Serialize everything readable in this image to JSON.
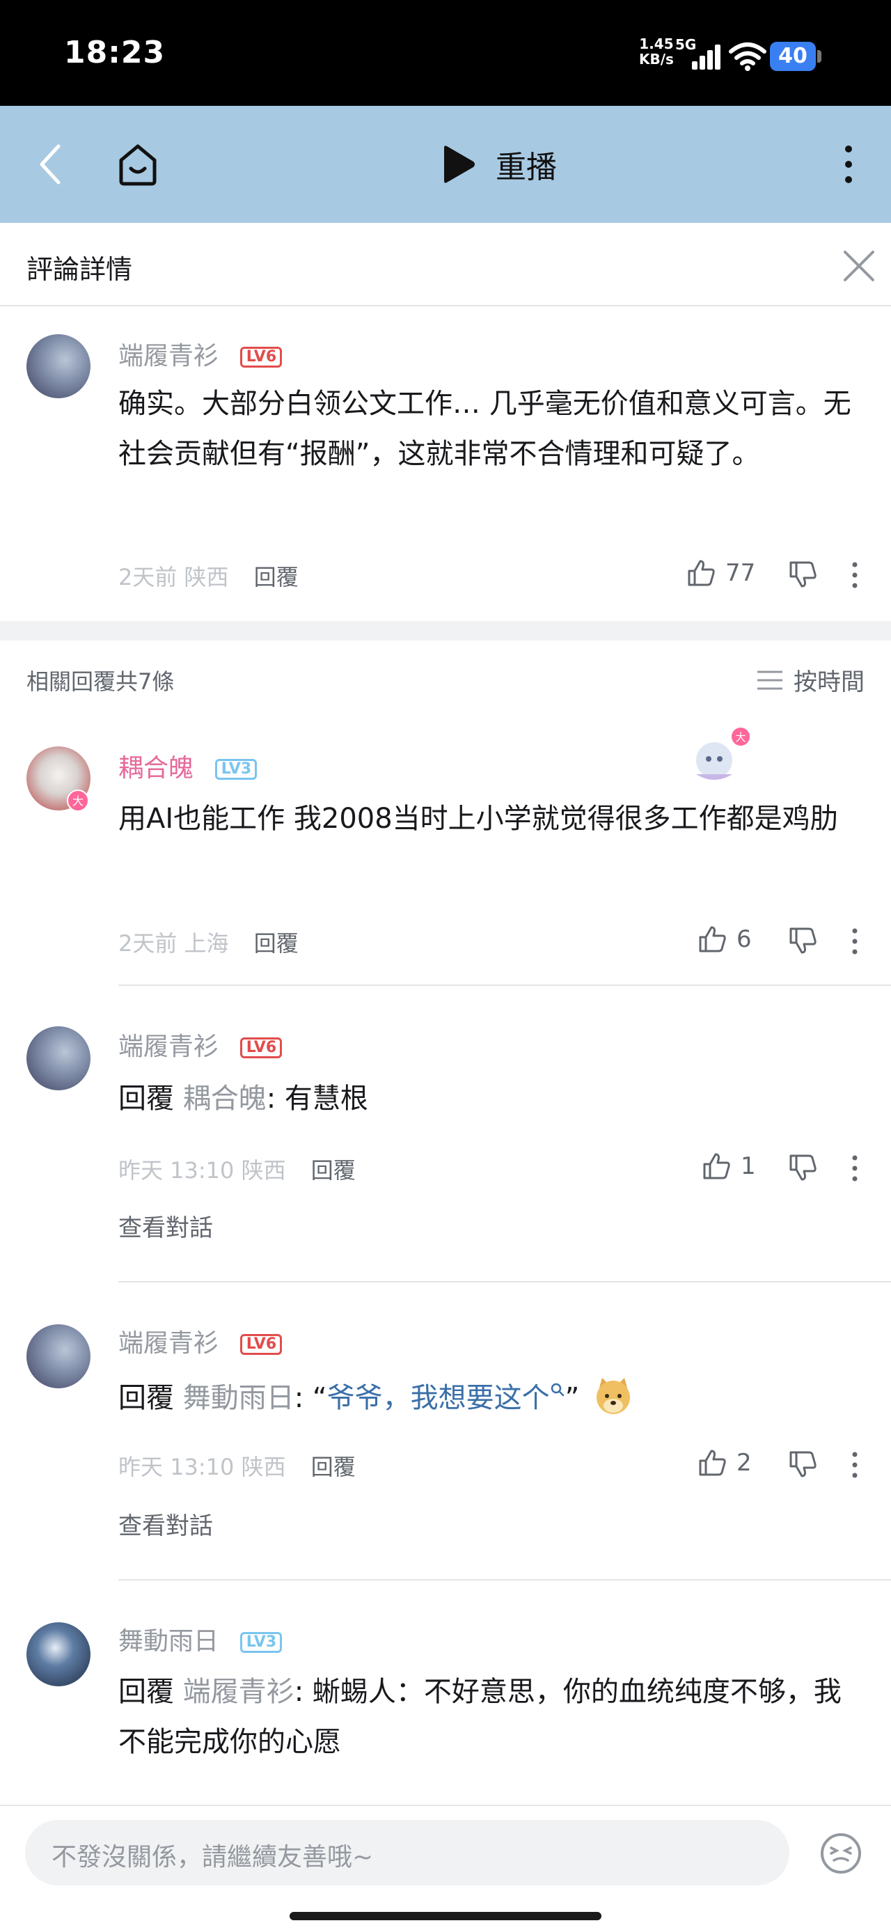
{
  "status_bar": {
    "time": "18:23",
    "net_speed": "1.45",
    "net_unit": "KB/s",
    "network": "5G",
    "battery": "40"
  },
  "nav": {
    "replay_label": "重播"
  },
  "detail": {
    "title": "評論詳情"
  },
  "main_comment": {
    "username": "端履青衫",
    "level": "LV6",
    "text": "确实。大部分白领公文工作… 几乎毫无价值和意义可言。无社会贡献但有“报酬”，这就非常不合情理和可疑了。",
    "time": "2天前",
    "location": "陕西",
    "reply_label": "回覆",
    "likes": "77"
  },
  "replies_header": {
    "count_label": "相關回覆共7條",
    "sort_label": "按時間"
  },
  "replies": [
    {
      "username": "耦合魄",
      "level": "LV3",
      "text": "用AI也能工作 我2008当时上小学就觉得很多工作都是鸡肋",
      "time": "2天前",
      "location": "上海",
      "reply_label": "回覆",
      "likes": "6",
      "username_color": "#e66a9a"
    },
    {
      "username": "端履青衫",
      "level": "LV6",
      "reply_prefix": "回覆",
      "reply_to": "耦合魄",
      "text": ": 有慧根",
      "time": "昨天 13:10",
      "location": "陕西",
      "reply_label": "回覆",
      "likes": "1",
      "view_conversation": "查看對話"
    },
    {
      "username": "端履青衫",
      "level": "LV6",
      "reply_prefix": "回覆",
      "reply_to": "舞動雨日",
      "text_prefix": ": “",
      "quoted": "爷爷，我想要这个",
      "text_suffix": "”",
      "time": "昨天 13:10",
      "location": "陕西",
      "reply_label": "回覆",
      "likes": "2",
      "view_conversation": "查看對話"
    },
    {
      "username": "舞動雨日",
      "level": "LV3",
      "reply_prefix": "回覆",
      "reply_to": "端履青衫",
      "text": ": 蜥蜴人：不好意思，你的血统纯度不够，我不能完成你的心愿"
    }
  ],
  "input": {
    "placeholder": "不發沒關係，請繼續友善哦~"
  },
  "colors": {
    "nav_bg": "#a8c9e2",
    "accent_pink": "#e66a9a",
    "link_blue": "#3a6fa8"
  }
}
